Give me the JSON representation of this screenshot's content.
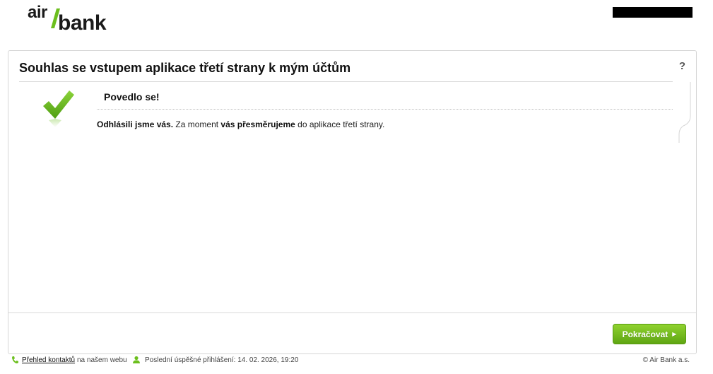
{
  "header": {
    "logo_text_air": "air",
    "logo_text_bank": "bank"
  },
  "panel": {
    "title": "Souhlas se vstupem aplikace třetí strany k mým účtům",
    "help_label": "?",
    "success_title": "Povedlo se!",
    "message_part1": "Odhlásili jsme vás.",
    "message_part2": " Za moment ",
    "message_part3": "vás přesměrujeme",
    "message_part4": " do aplikace třetí strany.",
    "continue_label": "Pokračovat"
  },
  "footer": {
    "contacts_link": "Přehled kontaktů",
    "contacts_suffix": "na našem webu",
    "last_login": "Poslední úspěšné přihlášení: 14. 02. 2026, 19:20",
    "copyright": "© Air Bank a.s."
  },
  "colors": {
    "brand_green": "#6cbf1e",
    "button_green": "#5fa612"
  },
  "icons": {
    "help": "question-icon",
    "check": "checkmark-icon",
    "phone": "phone-icon",
    "user": "user-icon",
    "arrow": "arrow-right-icon"
  }
}
